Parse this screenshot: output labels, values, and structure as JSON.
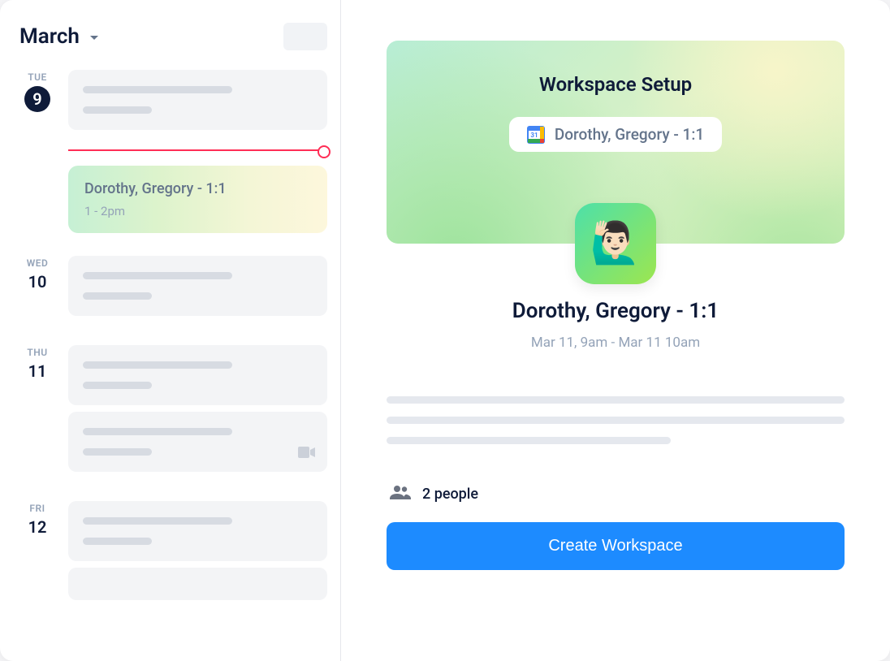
{
  "sidebar": {
    "month": "March",
    "days": [
      {
        "short": "TUE",
        "num": "9",
        "today": true
      },
      {
        "short": "WED",
        "num": "10",
        "today": false
      },
      {
        "short": "THU",
        "num": "11",
        "today": false
      },
      {
        "short": "FRI",
        "num": "12",
        "today": false
      }
    ],
    "highlighted_event": {
      "title": "Dorothy, Gregory - 1:1",
      "time": "1 - 2pm"
    }
  },
  "workspace": {
    "hero_title": "Workspace Setup",
    "source_event": "Dorothy, Gregory - 1:1",
    "avatar_emoji": "🙋🏻‍♂️",
    "title": "Dorothy, Gregory - 1:1",
    "time_range": "Mar 11, 9am - Mar 11 10am",
    "people_count": "2 people",
    "create_label": "Create Workspace"
  },
  "icons": {
    "gcal_day": "31"
  }
}
